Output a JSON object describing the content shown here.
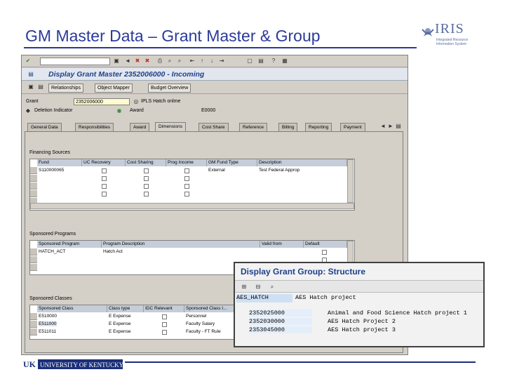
{
  "slide": {
    "title": "GM Master Data – Grant Master & Group",
    "logo_text": "IRIS",
    "logo_subtitle": "Integrated Resource Information System",
    "footer_logo_mark": "UK",
    "footer_logo_text": "UNIVERSITY OF KENTUCKY"
  },
  "sap": {
    "window_title": "Display Grant Master 2352006000 - Incoming",
    "app_buttons": [
      "Relationships",
      "Object Mapper",
      "Budget Overview"
    ],
    "grant_label": "Grant",
    "grant_value": "2352006000",
    "grant_desc": "IPLS Hatch onlme",
    "deletion_label": "Deletion Indicator",
    "award_label": "Award",
    "award_code": "E0000",
    "tabs": [
      "General Data",
      "Responsibilities",
      "Award",
      "Dimensions",
      "Cost Share",
      "Reference",
      "Billing",
      "Reporting",
      "Payment"
    ],
    "active_tab": "Dimensions",
    "financing": {
      "label": "Financing Sources",
      "headers": [
        "Fund",
        "UC Recovery",
        "Cost Sharing",
        "Prog Income",
        "GM Fund Type",
        "Description"
      ],
      "rows": [
        {
          "fund": "S110000065",
          "type": "External",
          "desc": "Test Federal Approp"
        }
      ]
    },
    "programs": {
      "label": "Sponsored Programs",
      "headers": [
        "Sponsored Program",
        "Program Description",
        "Valid from",
        "Default"
      ],
      "rows": [
        {
          "program": "HATCH_ACT",
          "desc": "Hatch Act"
        }
      ]
    },
    "classes": {
      "label": "Sponsored Classes",
      "headers": [
        "Sponsored Class",
        "Class type",
        "IDC Relevant",
        "Sponsored Class I..."
      ],
      "rows": [
        {
          "cls": "E510000",
          "type": "E Expense",
          "desc": ""
        },
        {
          "cls": "E511000",
          "type": "E Expense",
          "desc": "Faculty Salary"
        },
        {
          "cls": "E511011",
          "type": "E Expense",
          "desc": "Faculty - FT Rule"
        }
      ],
      "partial_row_desc": "Personnel"
    }
  },
  "overlay": {
    "title": "Display Grant Group: Structure",
    "root_id": "AES_HATCH",
    "root_desc": "AES Hatch project",
    "children": [
      {
        "id": "2352025000",
        "desc": "Animal and Food Science Hatch project 1"
      },
      {
        "id": "2352030000",
        "desc": "AES Hatch Project 2"
      },
      {
        "id": "2353045000",
        "desc": "AES Hatch project 3"
      }
    ]
  },
  "colors": {
    "title": "#2b3a99",
    "sap_bg": "#d4d0c8",
    "sap_title": "#20408a",
    "footer": "#1a2f7a"
  }
}
